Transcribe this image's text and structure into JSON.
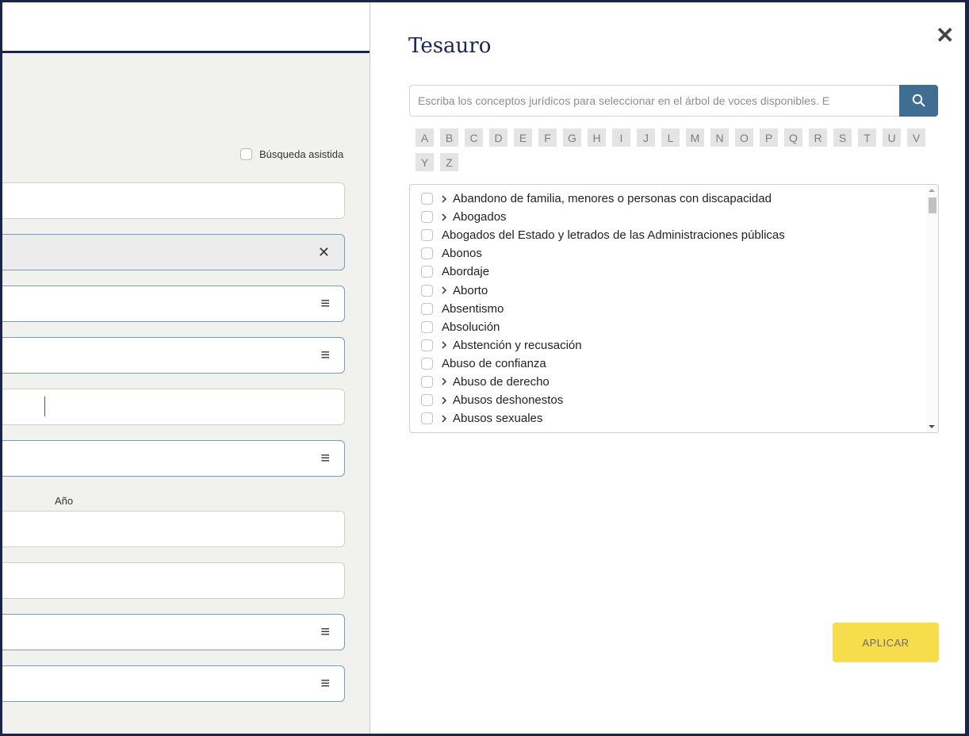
{
  "form": {
    "assisted_search_label": "Búsqueda asistida",
    "year_label": "Año",
    "clear_icon": "close-icon",
    "menu_icon": "hamburger-menu-icon"
  },
  "thesaurus": {
    "title": "Tesauro",
    "close_icon": "close-icon",
    "search_placeholder": "Escriba los conceptos jurídicos para seleccionar en el árbol de voces disponibles. E",
    "search_icon": "search-icon",
    "letters": [
      "A",
      "B",
      "C",
      "D",
      "E",
      "F",
      "G",
      "H",
      "I",
      "J",
      "L",
      "M",
      "N",
      "O",
      "P",
      "Q",
      "R",
      "S",
      "T",
      "U",
      "V",
      "Y",
      "Z"
    ],
    "terms": [
      {
        "label": "Abandono de familia, menores o personas con discapacidad",
        "expandable": true
      },
      {
        "label": "Abogados",
        "expandable": true
      },
      {
        "label": "Abogados del Estado y letrados de las Administraciones públicas",
        "expandable": false
      },
      {
        "label": "Abonos",
        "expandable": false
      },
      {
        "label": "Abordaje",
        "expandable": false
      },
      {
        "label": "Aborto",
        "expandable": true
      },
      {
        "label": "Absentismo",
        "expandable": false
      },
      {
        "label": "Absolución",
        "expandable": false
      },
      {
        "label": "Abstención y recusación",
        "expandable": true
      },
      {
        "label": "Abuso de confianza",
        "expandable": false
      },
      {
        "label": "Abuso de derecho",
        "expandable": true
      },
      {
        "label": "Abusos deshonestos",
        "expandable": true
      },
      {
        "label": "Abusos sexuales",
        "expandable": true
      }
    ],
    "apply_label": "APLICAR",
    "accent_color": "#3f6e92",
    "apply_color": "#f7dc4c"
  }
}
